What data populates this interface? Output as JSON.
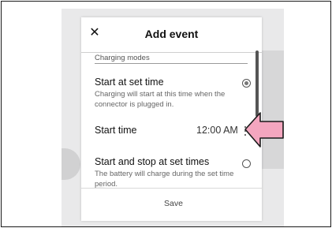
{
  "dialog": {
    "title": "Add event",
    "close_glyph": "✕",
    "section_label": "Charging modes",
    "option1": {
      "title": "Start at set time",
      "description": "Charging will  start at this time when the connector is plugged in.",
      "selected": true
    },
    "start_time": {
      "label": "Start time",
      "value": "12:00 AM"
    },
    "option2": {
      "title": "Start and stop at set times",
      "description": "The battery will charge during the set time period.",
      "selected": false
    },
    "save_label": "Save"
  },
  "icons": {
    "close": "close-icon",
    "more": "more-vertical-icon",
    "search": "search-icon",
    "callout": "pointer-arrow-icon"
  },
  "colors": {
    "callout_fill": "#f4a6bf",
    "fab_background": "#5a5a5a",
    "radio_selected": "#777777"
  }
}
